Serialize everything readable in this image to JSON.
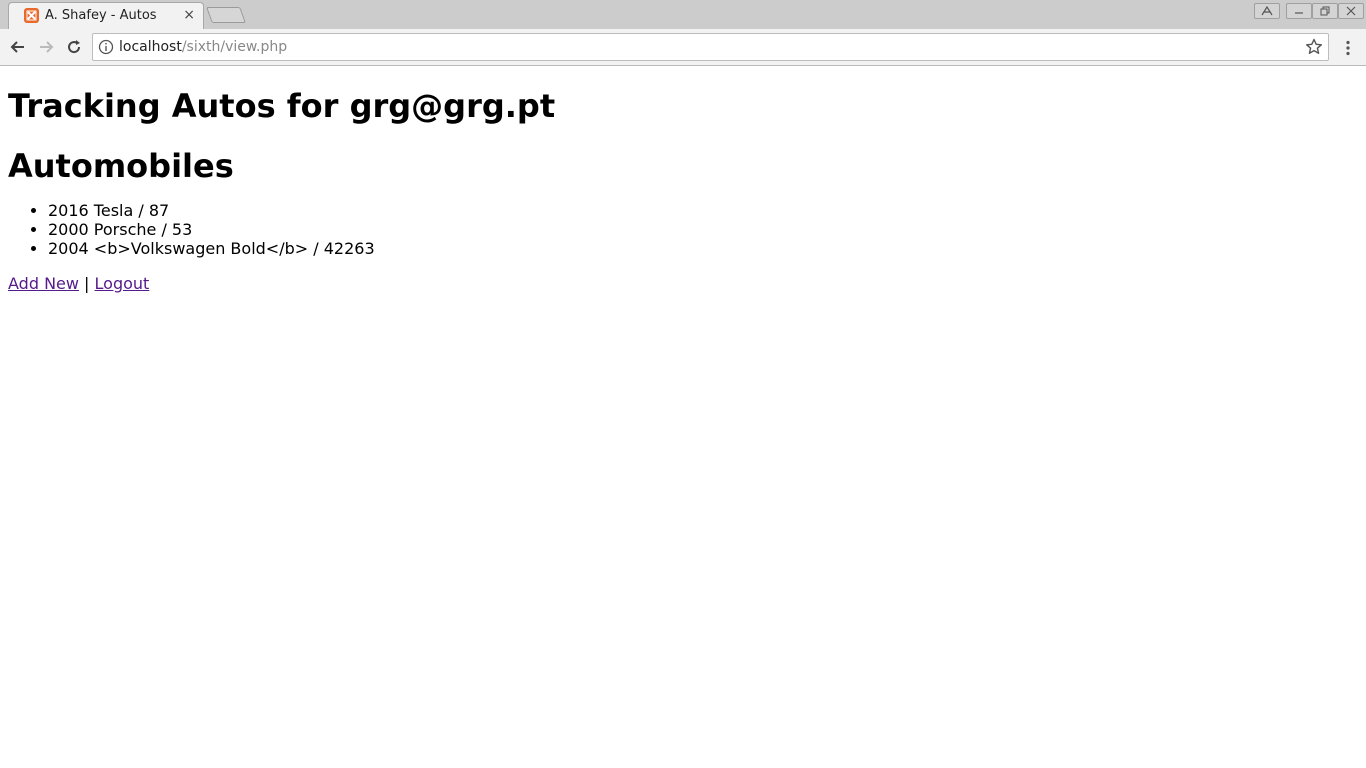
{
  "browser": {
    "tab": {
      "title": "A. Shafey - Autos",
      "close_glyph": "×",
      "favicon": "xampp-icon",
      "favicon_color": "#e8692a"
    },
    "address": {
      "host": "localhost",
      "path": "/sixth/view.php"
    }
  },
  "page": {
    "heading": "Tracking Autos for grg@grg.pt",
    "subheading": "Automobiles",
    "autos": [
      "2016 Tesla / 87",
      "2000 Porsche / 53",
      "2004 <b>Volkswagen Bold</b> / 42263"
    ],
    "links": {
      "add_new": "Add New",
      "separator": " | ",
      "logout": "Logout"
    },
    "link_color": "#551a8b"
  }
}
